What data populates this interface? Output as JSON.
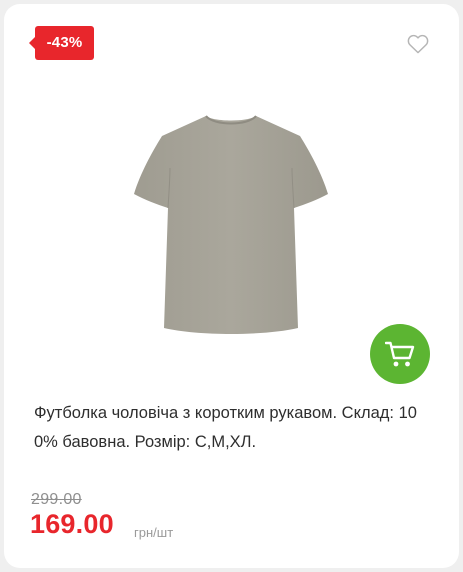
{
  "badge": {
    "discount": "-43%",
    "color": "#e8262c"
  },
  "icons": {
    "favorite": "heart-outline-icon",
    "cart": "shopping-cart-icon"
  },
  "product": {
    "image_alt": "tshirt-product-image",
    "title": "Футболка чоловіча з коротким рукавом. Склад: 100% бавовна. Розмір: С,М,ХЛ.",
    "shirt_color": "#a6a398"
  },
  "price": {
    "old": "299.00",
    "new": "169.00",
    "unit": "грн/шт",
    "new_color": "#e8262c"
  },
  "cart_button": {
    "color": "#5cb532"
  }
}
